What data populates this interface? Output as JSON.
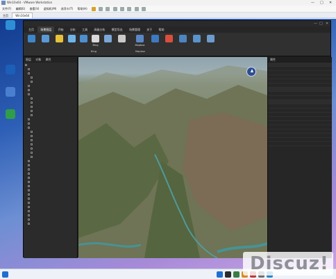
{
  "host": {
    "title": "Win10x64 - VMware Workstation",
    "menu": [
      "文件(F)",
      "编辑(E)",
      "查看(V)",
      "虚拟机(M)",
      "选项卡(T)",
      "帮助(H)"
    ],
    "tabs": [
      "主页",
      "Win10x64"
    ],
    "controls": [
      "—",
      "□",
      "✕"
    ]
  },
  "desktop_icons": [
    {
      "label": "",
      "color": "#2f8fd6"
    },
    {
      "label": "",
      "color": "#1d5fb8"
    },
    {
      "label": "",
      "color": "#4a7fd0"
    },
    {
      "label": "",
      "color": "#2f9d4a"
    }
  ],
  "app": {
    "title": "",
    "controls": [
      "—",
      "□",
      "✕"
    ],
    "ribbon_tabs": [
      "主页",
      "场景图层",
      "开始",
      "分析",
      "工具",
      "高级分析",
      "模型导出",
      "场景管理",
      "关于",
      "帮助"
    ],
    "ribbon_buttons": [
      {
        "label": "",
        "color": "#3e86c9"
      },
      {
        "label": "",
        "color": "#5a98d6"
      },
      {
        "label": "",
        "color": "#e7c13a"
      },
      {
        "label": "",
        "color": "#6fb4e8"
      },
      {
        "label": "",
        "color": "#4d8fcf"
      },
      {
        "label": "Bing",
        "color": "#d9d9d9"
      },
      {
        "label": "",
        "color": "#7aa7d8"
      },
      {
        "label": "",
        "color": "#c9c9c9"
      },
      {
        "label": "Mapbox",
        "color": "#5b87c6"
      },
      {
        "label": "",
        "color": "#3d7ac0"
      },
      {
        "label": "",
        "color": "#d94f3d"
      },
      {
        "label": "",
        "color": "#4c85c2"
      },
      {
        "label": "",
        "color": "#5a93cc"
      },
      {
        "label": "",
        "color": "#6d9bd0"
      }
    ],
    "ribbon_row2": [
      "",
      "",
      "",
      "",
      "",
      "Bing",
      "",
      "",
      "Mapbox",
      "",
      "",
      "",
      "",
      ""
    ],
    "left_panel": {
      "tabs": [
        "图层",
        "对象",
        "属性"
      ],
      "items": [
        "",
        "",
        "",
        "",
        "",
        "",
        "",
        "",
        "",
        "",
        "",
        "",
        "",
        "",
        "",
        "",
        "",
        "",
        "",
        "",
        "",
        "",
        "",
        "",
        "",
        "",
        "",
        "",
        "",
        "",
        "",
        "",
        "",
        "",
        "",
        "",
        "",
        "",
        ""
      ]
    },
    "viewport": {
      "top_text": "",
      "bottom_left": [
        "",
        "",
        "",
        ""
      ]
    },
    "right_panel": {
      "header": "属性",
      "rows": [
        {
          "k": "",
          "v": "",
          "group": true
        },
        {
          "k": "",
          "v": ""
        },
        {
          "k": "",
          "v": ""
        },
        {
          "k": "",
          "v": ""
        },
        {
          "k": "",
          "v": ""
        },
        {
          "k": "",
          "v": ""
        },
        {
          "k": "",
          "v": "",
          "group": true
        },
        {
          "k": "",
          "v": ""
        },
        {
          "k": "",
          "v": ""
        },
        {
          "k": "",
          "v": "",
          "group": true
        },
        {
          "k": "",
          "v": ""
        },
        {
          "k": "",
          "v": ""
        },
        {
          "k": "",
          "v": ""
        },
        {
          "k": "",
          "v": ""
        },
        {
          "k": "",
          "v": ""
        },
        {
          "k": "",
          "v": ""
        },
        {
          "k": "",
          "v": ""
        },
        {
          "k": "",
          "v": ""
        },
        {
          "k": "",
          "v": ""
        },
        {
          "k": "",
          "v": ""
        }
      ]
    }
  },
  "taskbar_items": [
    {
      "color": "#1f6fd0"
    },
    {
      "color": "#2b2b2b"
    },
    {
      "color": "#3a7d44"
    },
    {
      "color": "#d98a1f"
    },
    {
      "color": "#b83a3a"
    },
    {
      "color": "#6f6f6f"
    },
    {
      "color": "#2e86c1"
    }
  ],
  "watermark": {
    "text": "Discuz!"
  }
}
